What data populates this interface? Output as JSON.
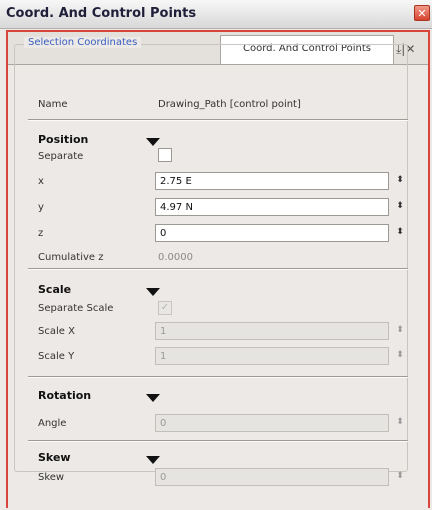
{
  "window": {
    "title": "Coord. And Control Points",
    "close_glyph": "✕"
  },
  "tab": {
    "label": "Coord. And Control Points",
    "tools_glyph": "⤓|✕"
  },
  "group": {
    "legend": "Selection Coordinates"
  },
  "name_row": {
    "label": "Name",
    "value": "Drawing_Path [control point]"
  },
  "position": {
    "title": "Position",
    "separate_label": "Separate",
    "separate_checked": false,
    "x_label": "x",
    "x_value": "2.75 E",
    "y_label": "y",
    "y_value": "4.97 N",
    "z_label": "z",
    "z_value": "0",
    "cumz_label": "Cumulative z",
    "cumz_value": "0.0000"
  },
  "scale": {
    "title": "Scale",
    "separate_label": "Separate Scale",
    "separate_checked": true,
    "check_glyph": "✓",
    "x_label": "Scale X",
    "x_value": "1",
    "y_label": "Scale Y",
    "y_value": "1"
  },
  "rotation": {
    "title": "Rotation",
    "angle_label": "Angle",
    "angle_value": "0"
  },
  "skew": {
    "title": "Skew",
    "skew_label": "Skew",
    "skew_value": "0"
  },
  "spinner_glyph": "⬍",
  "colors": {
    "accent_border": "#d9453a",
    "legend_blue": "#3a5fbf"
  }
}
